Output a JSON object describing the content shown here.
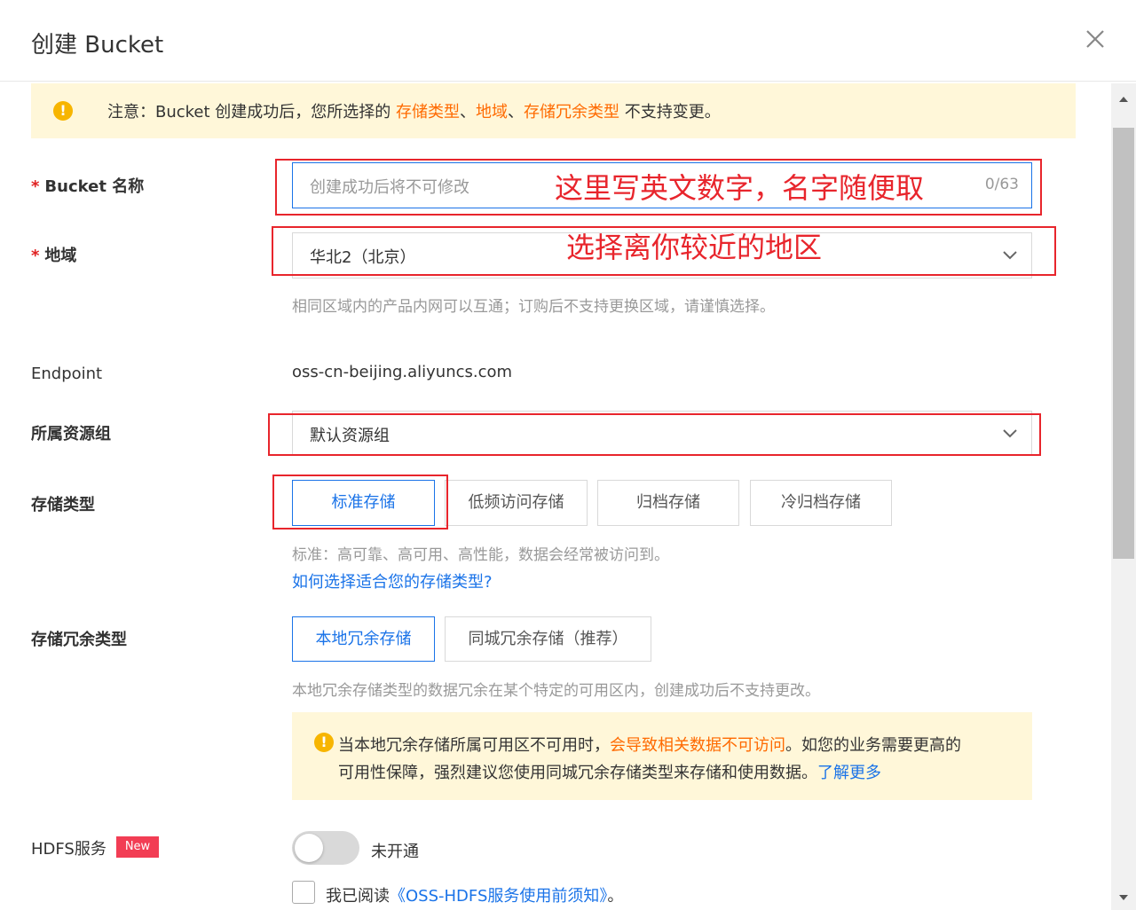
{
  "dialog": {
    "title": "创建 Bucket",
    "close_icon": "close-icon"
  },
  "notice": {
    "prefix": "注意：Bucket 创建成功后，您所选择的 ",
    "h1": "存储类型",
    "sep1": "、",
    "h2": "地域",
    "sep2": "、",
    "h3": "存储冗余类型",
    "suffix": " 不支持变更。"
  },
  "bucket_name": {
    "required_mark": "*",
    "label": "Bucket 名称",
    "placeholder": "创建成功后将不可修改",
    "counter": "0/63",
    "annotation": "这里写英文数字，名字随便取"
  },
  "region": {
    "required_mark": "*",
    "label": "地域",
    "value": "华北2（北京）",
    "hint": "相同区域内的产品内网可以互通；订购后不支持更换区域，请谨慎选择。",
    "annotation": "选择离你较近的地区"
  },
  "endpoint": {
    "label": "Endpoint",
    "value": "oss-cn-beijing.aliyuncs.com"
  },
  "resource_group": {
    "label": "所属资源组",
    "value": "默认资源组"
  },
  "storage_class": {
    "label": "存储类型",
    "options": [
      "标准存储",
      "低频访问存储",
      "归档存储",
      "冷归档存储"
    ],
    "selected": "标准存储",
    "hint": "标准：高可靠、高可用、高性能，数据会经常被访问到。",
    "link": "如何选择适合您的存储类型?"
  },
  "redundancy": {
    "label": "存储冗余类型",
    "options": [
      "本地冗余存储",
      "同城冗余存储（推荐）"
    ],
    "selected": "本地冗余存储",
    "hint": "本地冗余存储类型的数据冗余在某个特定的可用区内，创建成功后不支持更改。",
    "warning": {
      "line1_a": "当本地冗余存储所属可用区不可用时，",
      "line1_b": "会导致相关数据不可访问",
      "line1_c": "。如您的业务需要更高的",
      "line2": "可用性保障，强烈建议您使用同城冗余存储类型来存储和使用数据。",
      "link": "了解更多"
    }
  },
  "hdfs": {
    "label": "HDFS服务",
    "badge": "New",
    "status": "未开通",
    "enabled": false,
    "agree_prefix": "我已阅读",
    "agree_link": "《OSS-HDFS服务使用前须知》",
    "agree_suffix": "。",
    "checked": false
  },
  "colors": {
    "accent": "#1a73e8",
    "highlight": "#ff6a00",
    "annotation": "#e8252c",
    "notice_bg": "#fff7d9",
    "badge": "#f23d54"
  }
}
